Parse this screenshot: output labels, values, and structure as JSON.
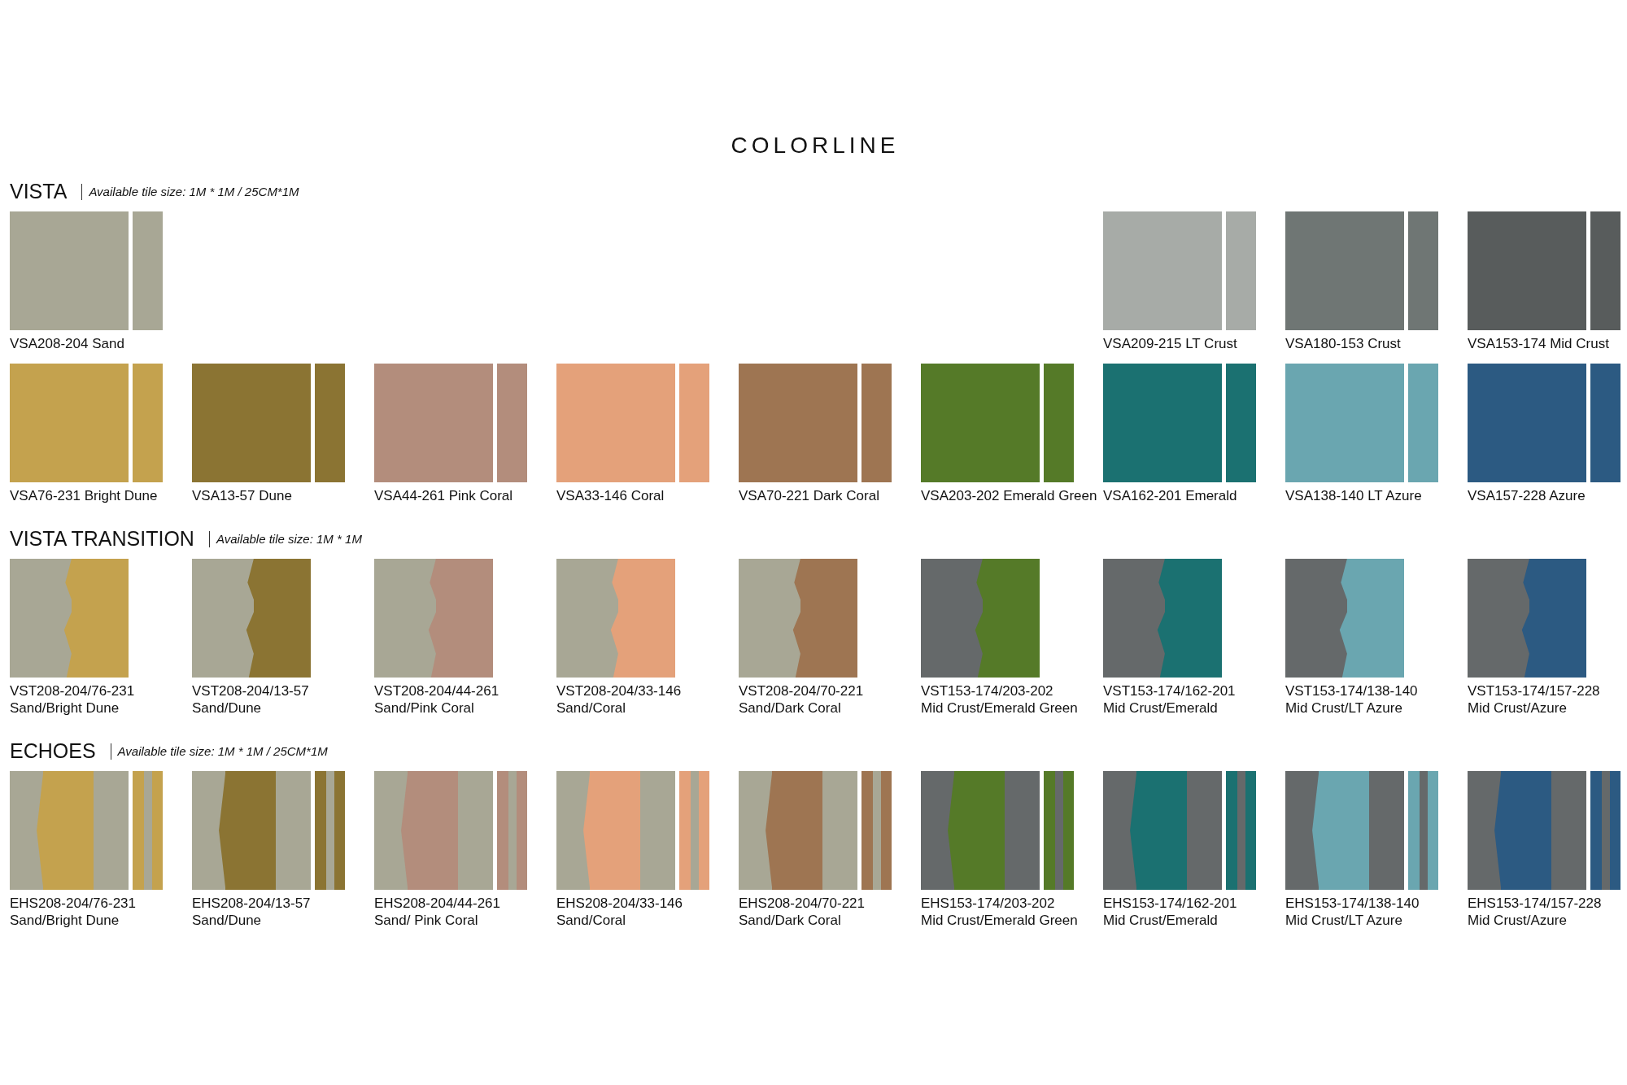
{
  "title": "COLORLINE",
  "sections": [
    {
      "name": "VISTA",
      "note": "Available tile size: 1M * 1M / 25CM*1M",
      "kind": "full",
      "rows": [
        {
          "kind": "split",
          "items": [
            {
              "lines": [
                "VSA208-204 Sand"
              ],
              "color": "#a8a795"
            },
            {
              "lines": [
                "VSA209-215 LT Crust"
              ],
              "color": "#a7aba7"
            },
            {
              "lines": [
                "VSA180-153 Crust"
              ],
              "color": "#6f7674"
            },
            {
              "lines": [
                "VSA153-174 Mid Crust"
              ],
              "color": "#585c5c"
            }
          ]
        },
        {
          "kind": "grid",
          "items": [
            {
              "lines": [
                "VSA76-231 Bright Dune"
              ],
              "color": "#c4a24e"
            },
            {
              "lines": [
                "VSA13-57 Dune"
              ],
              "color": "#8b7433"
            },
            {
              "lines": [
                "VSA44-261 Pink Coral"
              ],
              "color": "#b38d7c"
            },
            {
              "lines": [
                "VSA33-146 Coral"
              ],
              "color": "#e4a17a"
            },
            {
              "lines": [
                "VSA70-221 Dark Coral"
              ],
              "color": "#9e7552"
            },
            {
              "lines": [
                "VSA203-202 Emerald Green"
              ],
              "color": "#557a28"
            },
            {
              "lines": [
                "VSA162-201 Emerald"
              ],
              "color": "#1b7171"
            },
            {
              "lines": [
                "VSA138-140 LT Azure"
              ],
              "color": "#6aa6b0"
            },
            {
              "lines": [
                "VSA157-228 Azure"
              ],
              "color": "#2c5a82"
            }
          ]
        }
      ]
    },
    {
      "name": "VISTA TRANSITION",
      "note": "Available tile size: 1M * 1M",
      "kind": "transition",
      "rows": [
        {
          "kind": "grid",
          "items": [
            {
              "lines": [
                "VST208-204/76-231",
                "Sand/Bright Dune"
              ],
              "base": {
                "color": "#a8a795"
              },
              "color": "#c4a24e"
            },
            {
              "lines": [
                "VST208-204/13-57",
                "Sand/Dune"
              ],
              "base": {
                "color": "#a8a795"
              },
              "color": "#8b7433"
            },
            {
              "lines": [
                "VST208-204/44-261",
                "Sand/Pink Coral"
              ],
              "base": {
                "color": "#a8a795"
              },
              "color": "#b38d7c"
            },
            {
              "lines": [
                "VST208-204/33-146",
                "Sand/Coral"
              ],
              "base": {
                "color": "#a8a795"
              },
              "color": "#e4a17a"
            },
            {
              "lines": [
                "VST208-204/70-221",
                "Sand/Dark Coral"
              ],
              "base": {
                "color": "#a8a795"
              },
              "color": "#9e7552"
            },
            {
              "lines": [
                "VST153-174/203-202",
                "Mid Crust/Emerald Green"
              ],
              "base": {
                "color": "#65696a"
              },
              "color": "#557a28"
            },
            {
              "lines": [
                "VST153-174/162-201",
                "Mid Crust/Emerald"
              ],
              "base": {
                "color": "#65696a"
              },
              "color": "#1b7171"
            },
            {
              "lines": [
                "VST153-174/138-140",
                "Mid Crust/LT Azure"
              ],
              "base": {
                "color": "#65696a"
              },
              "color": "#6aa6b0"
            },
            {
              "lines": [
                "VST153-174/157-228",
                "Mid Crust/Azure"
              ],
              "base": {
                "color": "#65696a"
              },
              "color": "#2c5a82"
            }
          ]
        }
      ]
    },
    {
      "name": "ECHOES",
      "note": "Available tile size: 1M * 1M / 25CM*1M",
      "kind": "echo",
      "rows": [
        {
          "kind": "grid",
          "items": [
            {
              "lines": [
                "EHS208-204/76-231",
                "Sand/Bright Dune"
              ],
              "base": {
                "color": "#a8a795"
              },
              "color": "#c4a24e"
            },
            {
              "lines": [
                "EHS208-204/13-57",
                "Sand/Dune"
              ],
              "base": {
                "color": "#a8a795"
              },
              "color": "#8b7433"
            },
            {
              "lines": [
                "EHS208-204/44-261",
                "Sand/ Pink Coral"
              ],
              "base": {
                "color": "#a8a795"
              },
              "color": "#b38d7c"
            },
            {
              "lines": [
                "EHS208-204/33-146",
                "Sand/Coral"
              ],
              "base": {
                "color": "#a8a795"
              },
              "color": "#e4a17a"
            },
            {
              "lines": [
                "EHS208-204/70-221",
                "Sand/Dark Coral"
              ],
              "base": {
                "color": "#a8a795"
              },
              "color": "#9e7552"
            },
            {
              "lines": [
                "EHS153-174/203-202",
                "Mid Crust/Emerald Green"
              ],
              "base": {
                "color": "#65696a"
              },
              "color": "#557a28"
            },
            {
              "lines": [
                "EHS153-174/162-201",
                "Mid Crust/Emerald"
              ],
              "base": {
                "color": "#65696a"
              },
              "color": "#1b7171"
            },
            {
              "lines": [
                "EHS153-174/138-140",
                "Mid Crust/LT Azure"
              ],
              "base": {
                "color": "#65696a"
              },
              "color": "#6aa6b0"
            },
            {
              "lines": [
                "EHS153-174/157-228",
                "Mid Crust/Azure"
              ],
              "base": {
                "color": "#65696a"
              },
              "color": "#2c5a82"
            }
          ]
        }
      ]
    }
  ]
}
